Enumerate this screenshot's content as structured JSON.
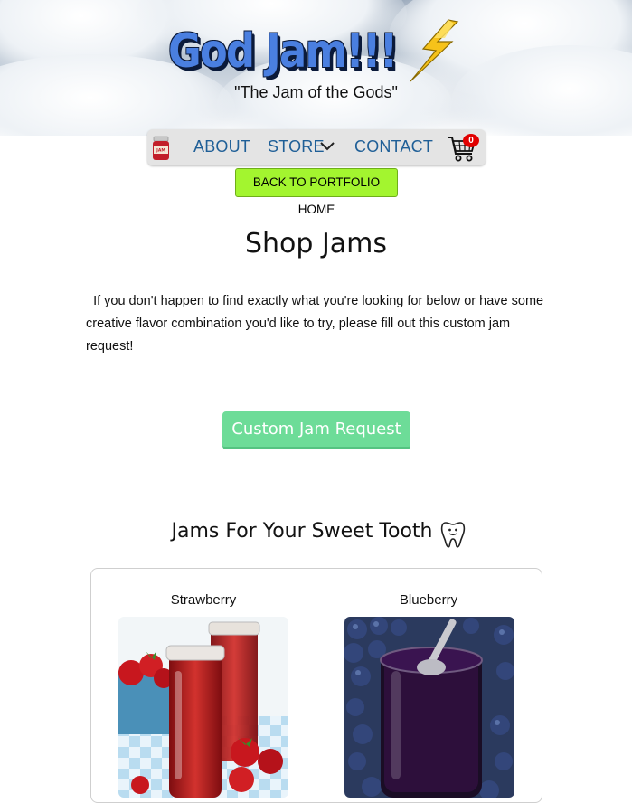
{
  "header": {
    "brand": "God Jam!!!",
    "tagline": "\"The Jam of the Gods\""
  },
  "nav": {
    "logo": "jam-jar-logo",
    "items": [
      {
        "label": "ABOUT"
      },
      {
        "label": "STORE"
      },
      {
        "label": "CONTACT"
      }
    ],
    "cart_count": "0"
  },
  "back_button": "BACK TO PORTFOLIO HOME",
  "main": {
    "title": "Shop Jams",
    "intro": "If you don't happen to find exactly what you're looking for below or have some creative flavor combination you'd like to try, please fill out this custom jam request!",
    "custom_button": "Custom Jam Request"
  },
  "section": {
    "title": "Jams For Your Sweet Tooth",
    "icon": "tooth-icon"
  },
  "products": [
    {
      "name": "Strawberry"
    },
    {
      "name": "Blueberry"
    }
  ],
  "colors": {
    "nav_link": "#1f5f97",
    "back_button": "#a3f52f",
    "custom_button": "#6ddc98",
    "brand": "#4a7fe0",
    "badge": "#e10000"
  }
}
